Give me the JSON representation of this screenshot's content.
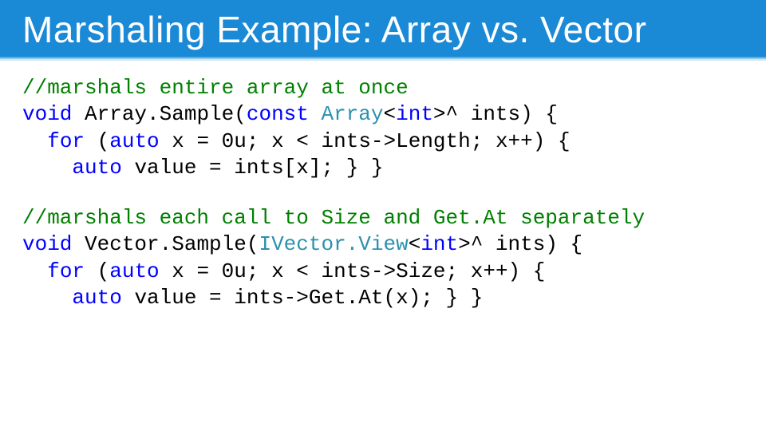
{
  "slide": {
    "title": "Marshaling Example: Array vs. Vector"
  },
  "code1": {
    "l1_comment": "//marshals entire array at once",
    "l2_kw1": "void",
    "l2_fn_open": " Array.Sample(",
    "l2_kw2": "const",
    "l2_spc": " ",
    "l2_type": "Array",
    "l2_after_type": "<",
    "l2_int": "int",
    "l2_tail": ">^ ints) {",
    "l3_indent": "  ",
    "l3_kw1": "for",
    "l3_paren": " (",
    "l3_kw2": "auto",
    "l3_tail": " x = 0u; x < ints->Length; x++) {",
    "l4_indent": "    ",
    "l4_kw": "auto",
    "l4_tail": " value = ints[x]; } }"
  },
  "code2": {
    "l1_comment": "//marshals each call to Size and Get.At separately",
    "l2_kw1": "void",
    "l2_fn_open": " Vector.Sample(",
    "l2_type": "IVector.View",
    "l2_after_type": "<",
    "l2_int": "int",
    "l2_tail": ">^ ints) {",
    "l3_indent": "  ",
    "l3_kw1": "for",
    "l3_paren": " (",
    "l3_kw2": "auto",
    "l3_tail": " x = 0u; x < ints->Size; x++) {",
    "l4_indent": "    ",
    "l4_kw": "auto",
    "l4_tail": " value = ints->Get.At(x); } }"
  }
}
